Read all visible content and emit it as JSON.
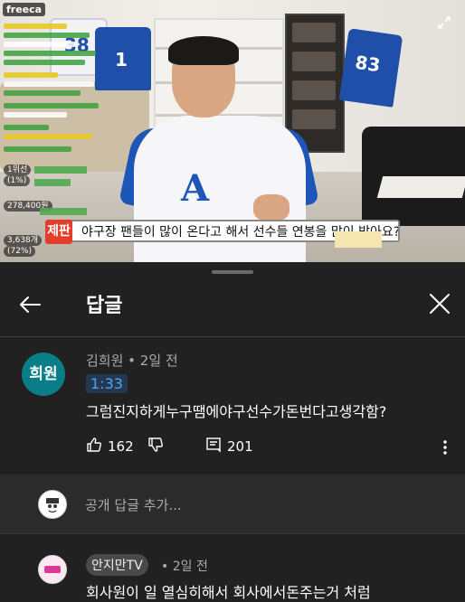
{
  "video": {
    "watermark": "freeca",
    "caption_tag": "제판",
    "caption": "야구장 팬들이 많이 온다고 해서 선수들 연봉을 많이 받아요?",
    "stats": [
      "1위선",
      "(1%)",
      "278,400원",
      "3,638개",
      "(72%)"
    ],
    "jersey_numbers": [
      "38",
      "1",
      "83"
    ]
  },
  "sheet": {
    "title": "답글",
    "back_icon": "arrow-left-icon",
    "close_icon": "close-icon"
  },
  "comment": {
    "avatar_text": "희원",
    "author": "김희원 • 2일 전",
    "timestamp": "1:33",
    "text": "그럼진지하게누구땜에야구선수가돈번다고생각함?",
    "likes": "162",
    "replies": "201"
  },
  "add_reply": {
    "placeholder": "공개 답글 추가..."
  },
  "reply2": {
    "author": "안지만TV",
    "time": "• 2일 전",
    "text": "회사원이 일 열심히해서 회사에서돈주는거 처럼"
  },
  "colors": {
    "sheet_bg": "#212121",
    "link_blue": "#4ea3ff",
    "avatar_teal": "#0a7e88",
    "caption_red": "#e43d2a"
  }
}
